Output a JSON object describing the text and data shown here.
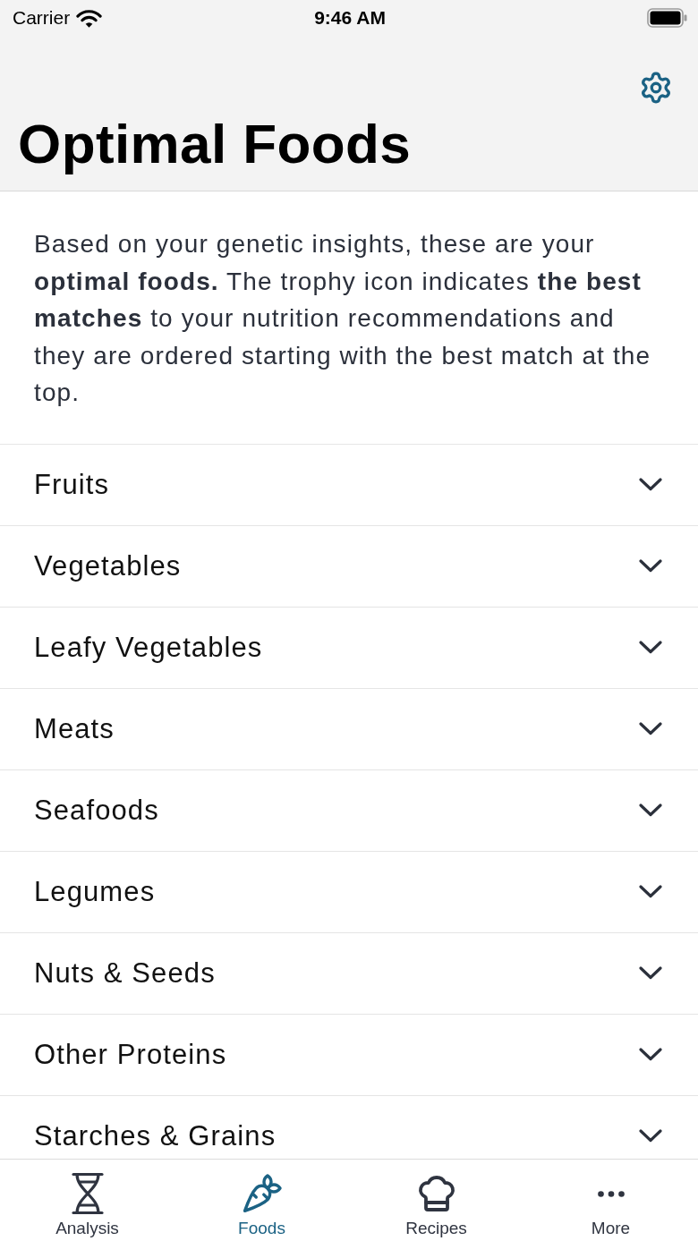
{
  "status_bar": {
    "carrier": "Carrier",
    "time": "9:46 AM"
  },
  "nav_bar": {
    "title": "Optimal Foods"
  },
  "intro": "Based on your genetic insights, these are your **optimal foods.** The trophy icon indicates **the best matches** to your nutrition recommendations and they are ordered starting with the best match at the top.",
  "categories": [
    {
      "label": "Fruits",
      "expanded": false
    },
    {
      "label": "Vegetables",
      "expanded": false
    },
    {
      "label": "Leafy Vegetables",
      "expanded": false
    },
    {
      "label": "Meats",
      "expanded": false
    },
    {
      "label": "Seafoods",
      "expanded": false
    },
    {
      "label": "Legumes",
      "expanded": false
    },
    {
      "label": "Nuts & Seeds",
      "expanded": false
    },
    {
      "label": "Other Proteins",
      "expanded": false
    },
    {
      "label": "Starches & Grains",
      "expanded": false
    }
  ],
  "tab_bar": [
    {
      "label": "Analysis",
      "selected": false
    },
    {
      "label": "Foods",
      "selected": true
    },
    {
      "label": "Recipes",
      "selected": false
    },
    {
      "label": "More",
      "selected": false
    }
  ]
}
